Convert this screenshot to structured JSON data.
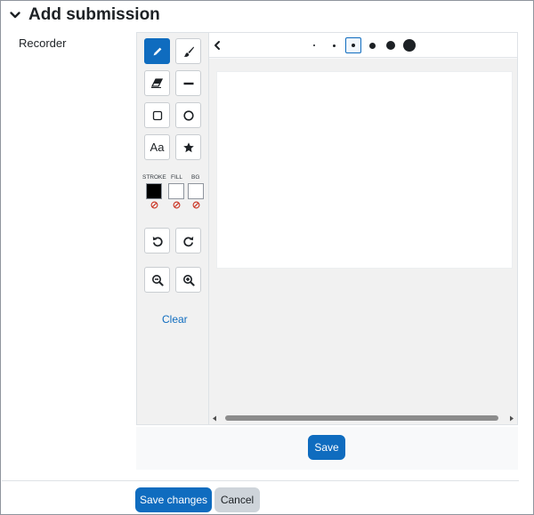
{
  "section": {
    "title": "Add submission",
    "icon": "chevron-down-icon"
  },
  "field": {
    "label": "Recorder"
  },
  "recorder": {
    "tools": [
      {
        "name": "pen",
        "icon": "pen-icon",
        "active": true
      },
      {
        "name": "brush",
        "icon": "brush-icon",
        "active": false
      },
      {
        "name": "eraser",
        "icon": "eraser-icon",
        "active": false
      },
      {
        "name": "line",
        "icon": "line-icon",
        "active": false
      },
      {
        "name": "rectangle",
        "icon": "rectangle-icon",
        "active": false
      },
      {
        "name": "circle",
        "icon": "circle-icon",
        "active": false
      },
      {
        "name": "text",
        "icon": "text-icon",
        "label": "Aa",
        "active": false
      },
      {
        "name": "stamp",
        "icon": "star-icon",
        "active": false
      }
    ],
    "colors": {
      "stroke_label": "STROKE",
      "fill_label": "FILL",
      "bg_label": "BG",
      "stroke_color": "#000000",
      "fill_color": "#ffffff",
      "bg_color": "#ffffff"
    },
    "history": [
      "undo-icon",
      "redo-icon"
    ],
    "zoom": [
      "zoom-out-icon",
      "zoom-in-icon"
    ],
    "clear_label": "Clear",
    "brush_sizes": {
      "count": 6,
      "selected_index": 2
    },
    "save_label": "Save"
  },
  "form": {
    "save_changes_label": "Save changes",
    "cancel_label": "Cancel"
  },
  "colors": {
    "primary": "#0f6cbf",
    "secondary": "#ced4da",
    "text": "#1d2125"
  }
}
